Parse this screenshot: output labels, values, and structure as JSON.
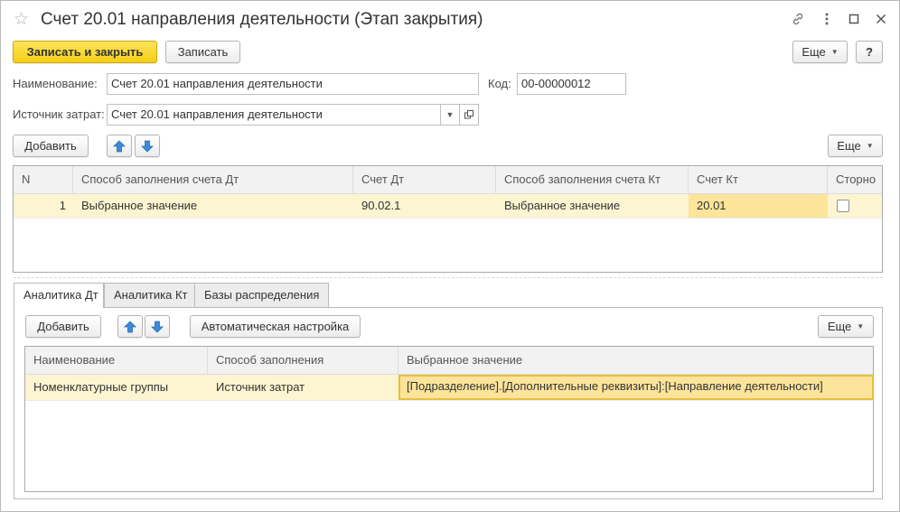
{
  "window": {
    "title": "Счет 20.01 направления деятельности (Этап закрытия)"
  },
  "toolbar": {
    "save_close_label": "Записать и закрыть",
    "save_label": "Записать",
    "more_label": "Еще",
    "help_label": "?"
  },
  "form": {
    "name_label": "Наименование:",
    "name_value": "Счет 20.01 направления деятельности",
    "code_label": "Код:",
    "code_value": "00-00000012",
    "source_label": "Источник затрат:",
    "source_value": "Счет 20.01 направления деятельности"
  },
  "top_table": {
    "add_label": "Добавить",
    "more_label": "Еще",
    "columns": [
      "N",
      "Способ заполнения счета Дт",
      "Счет Дт",
      "Способ заполнения счета Кт",
      "Счет Кт",
      "Сторно"
    ],
    "rows": [
      {
        "n": "1",
        "dt_method": "Выбранное значение",
        "dt_account": "90.02.1",
        "kt_method": "Выбранное значение",
        "kt_account": "20.01",
        "storno": false
      }
    ]
  },
  "tabs": [
    "Аналитика Дт",
    "Аналитика Кт",
    "Базы распределения"
  ],
  "analytics": {
    "add_label": "Добавить",
    "auto_setup_label": "Автоматическая настройка",
    "more_label": "Еще",
    "columns": [
      "Наименование",
      "Способ заполнения",
      "Выбранное значение"
    ],
    "rows": [
      {
        "name": "Номенклатурные группы",
        "method": "Источник затрат",
        "value": "[Подразделение].[Дополнительные реквизиты]:[Направление деятельности]"
      }
    ]
  },
  "colors": {
    "primary_button": "#f5cf15",
    "row_highlight": "#fdf5d1",
    "cell_active": "#fce49a",
    "arrow_blue": "#3c8ad8"
  }
}
